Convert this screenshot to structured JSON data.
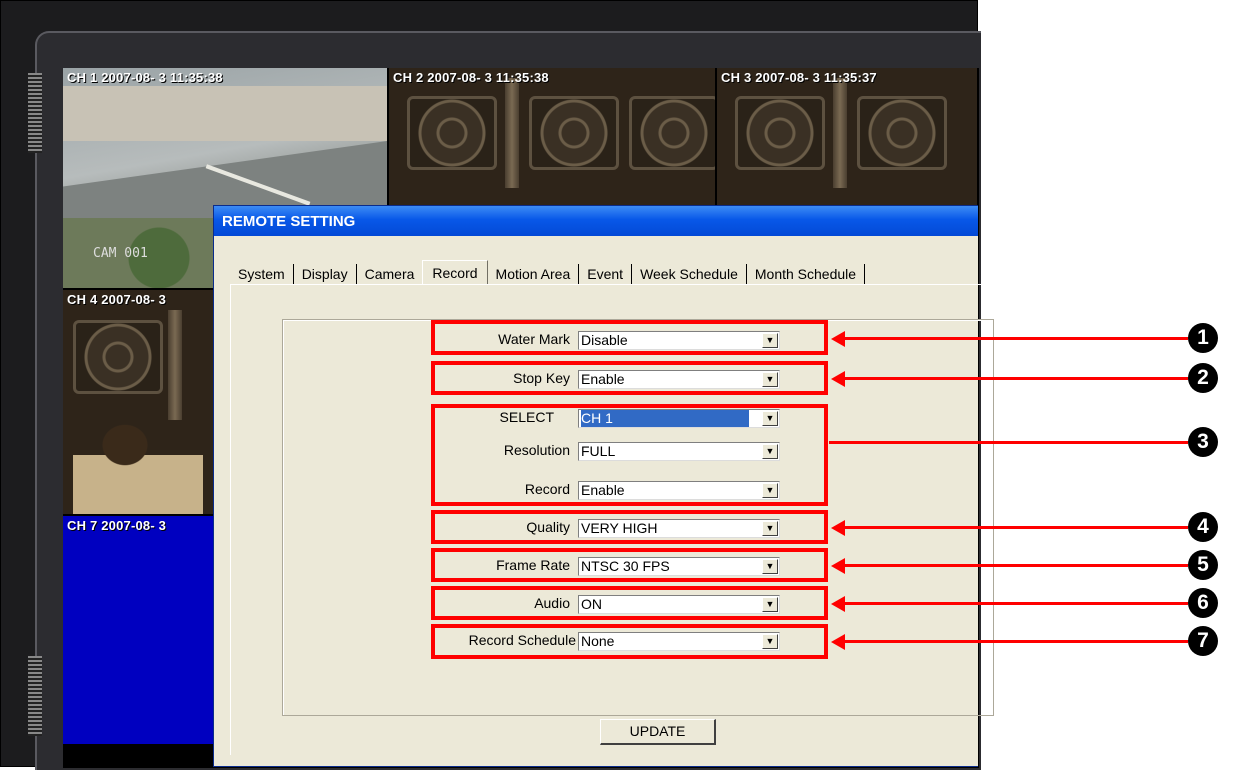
{
  "channels": [
    {
      "osd": "CH 1 2007-08- 3 11:35:38",
      "cam": "CAM 001"
    },
    {
      "osd": "CH 2 2007-08- 3 11:35:38"
    },
    {
      "osd": "CH 3 2007-08- 3 11:35:37"
    },
    {
      "osd": "CH 4 2007-08- 3"
    },
    {
      "osd": "CH 7 2007-08- 3"
    }
  ],
  "window": {
    "title": "REMOTE SETTING",
    "tabs": [
      "System",
      "Display",
      "Camera",
      "Record",
      "Motion Area",
      "Event",
      "Week Schedule",
      "Month Schedule"
    ],
    "active_tab": "Record"
  },
  "fields": {
    "water_mark": {
      "label": "Water Mark",
      "value": "Disable"
    },
    "stop_key": {
      "label": "Stop Key",
      "value": "Enable"
    },
    "select": {
      "label": "SELECT",
      "value": "CH 1"
    },
    "resolution": {
      "label": "Resolution",
      "value": "FULL"
    },
    "record": {
      "label": "Record",
      "value": "Enable"
    },
    "quality": {
      "label": "Quality",
      "value": "VERY HIGH"
    },
    "frame_rate": {
      "label": "Frame Rate",
      "value": "NTSC 30 FPS"
    },
    "audio": {
      "label": "Audio",
      "value": "ON"
    },
    "record_schedule": {
      "label": "Record Schedule",
      "value": "None"
    }
  },
  "update_label": "UPDATE",
  "callouts": [
    "1",
    "2",
    "3",
    "4",
    "5",
    "6",
    "7"
  ],
  "colors": {
    "highlight": "#ff0000",
    "titlebar": "#0858e8",
    "dialog_bg": "#ece9d8"
  }
}
